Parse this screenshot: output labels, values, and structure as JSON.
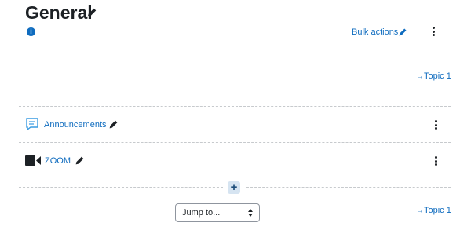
{
  "section": {
    "title": "General",
    "bulk_actions_label": "Bulk actions",
    "info_glyph": "i"
  },
  "activities": [
    {
      "label": "Announcements",
      "icon": "forum-icon"
    },
    {
      "label": "ZOOM",
      "icon": "video-camera-icon"
    }
  ],
  "topic_links": [
    "Topic 1",
    "Topic 1"
  ],
  "jump": {
    "label": "Jump to..."
  },
  "add_glyph": "+",
  "colors": {
    "link": "#0f6cbf",
    "text": "#1d2125",
    "divider": "#c7cacd"
  }
}
